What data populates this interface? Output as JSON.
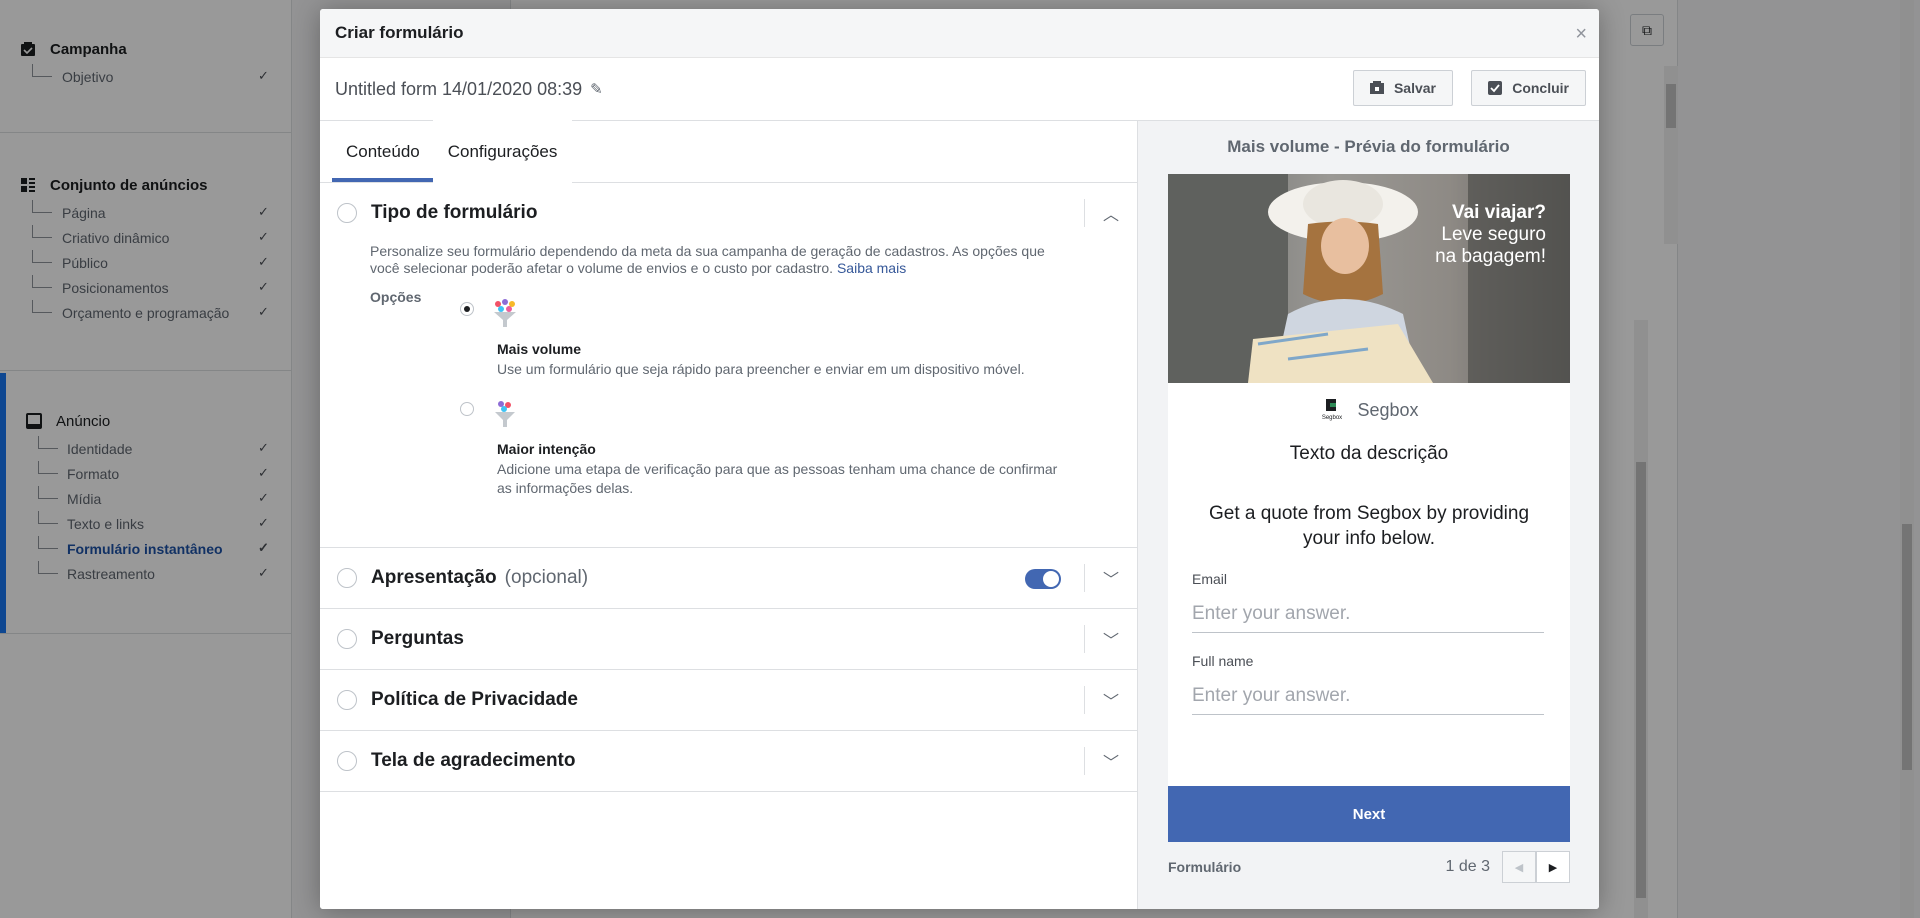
{
  "sidebar": {
    "campaign": {
      "title": "Campanha",
      "items": [
        {
          "label": "Objetivo"
        }
      ]
    },
    "adset": {
      "title": "Conjunto de anúncios",
      "items": [
        {
          "label": "Página"
        },
        {
          "label": "Criativo dinâmico"
        },
        {
          "label": "Público"
        },
        {
          "label": "Posicionamentos"
        },
        {
          "label": "Orçamento e programação"
        }
      ]
    },
    "ad": {
      "title": "Anúncio",
      "items": [
        {
          "label": "Identidade"
        },
        {
          "label": "Formato"
        },
        {
          "label": "Mídia"
        },
        {
          "label": "Texto e links"
        },
        {
          "label": "Formulário instantâneo"
        },
        {
          "label": "Rastreamento"
        }
      ]
    }
  },
  "modal": {
    "title": "Criar formulário",
    "close": "×",
    "form_name": "Untitled form 14/01/2020 08:39",
    "save_label": "Salvar",
    "done_label": "Concluir"
  },
  "tabs": [
    {
      "label": "Conteúdo"
    },
    {
      "label": "Configurações"
    }
  ],
  "sections": {
    "form_type": {
      "title": "Tipo de formulário",
      "description": "Personalize seu formulário dependendo da meta da sua campanha de geração de cadastros. As opções que você selecionar poderão afetar o volume de envios e o custo por cadastro.",
      "learn_more": "Saiba mais",
      "options_label": "Opções",
      "options": [
        {
          "title": "Mais volume",
          "text": "Use um formulário que seja rápido para preencher e enviar em um dispositivo móvel.",
          "selected": true
        },
        {
          "title": "Maior intenção",
          "text": "Adicione uma etapa de verificação para que as pessoas tenham uma chance de confirmar as informações delas.",
          "selected": false
        }
      ]
    },
    "intro": {
      "title": "Apresentação",
      "optional": "(opcional)",
      "enabled": true
    },
    "questions": {
      "title": "Perguntas"
    },
    "privacy": {
      "title": "Política de Privacidade"
    },
    "thanks": {
      "title": "Tela de agradecimento"
    }
  },
  "preview": {
    "title": "Mais volume - Prévia do formulário",
    "image_text": {
      "line1": "Vai viajar?",
      "line2": "Leve seguro",
      "line3": "na bagagem!"
    },
    "brand": "Segbox",
    "brand_logo_text": "Segbox",
    "description_title": "Texto da descrição",
    "intro": "Get a quote from Segbox by providing your info below.",
    "fields": [
      {
        "label": "Email",
        "placeholder": "Enter your answer."
      },
      {
        "label": "Full name",
        "placeholder": "Enter your answer."
      }
    ],
    "next_label": "Next",
    "footer_label": "Formulário",
    "pager": "1 de 3"
  },
  "colors": {
    "accent": "#4267b2",
    "link": "#365899",
    "overlay": "rgba(0,0,0,0.4)"
  }
}
